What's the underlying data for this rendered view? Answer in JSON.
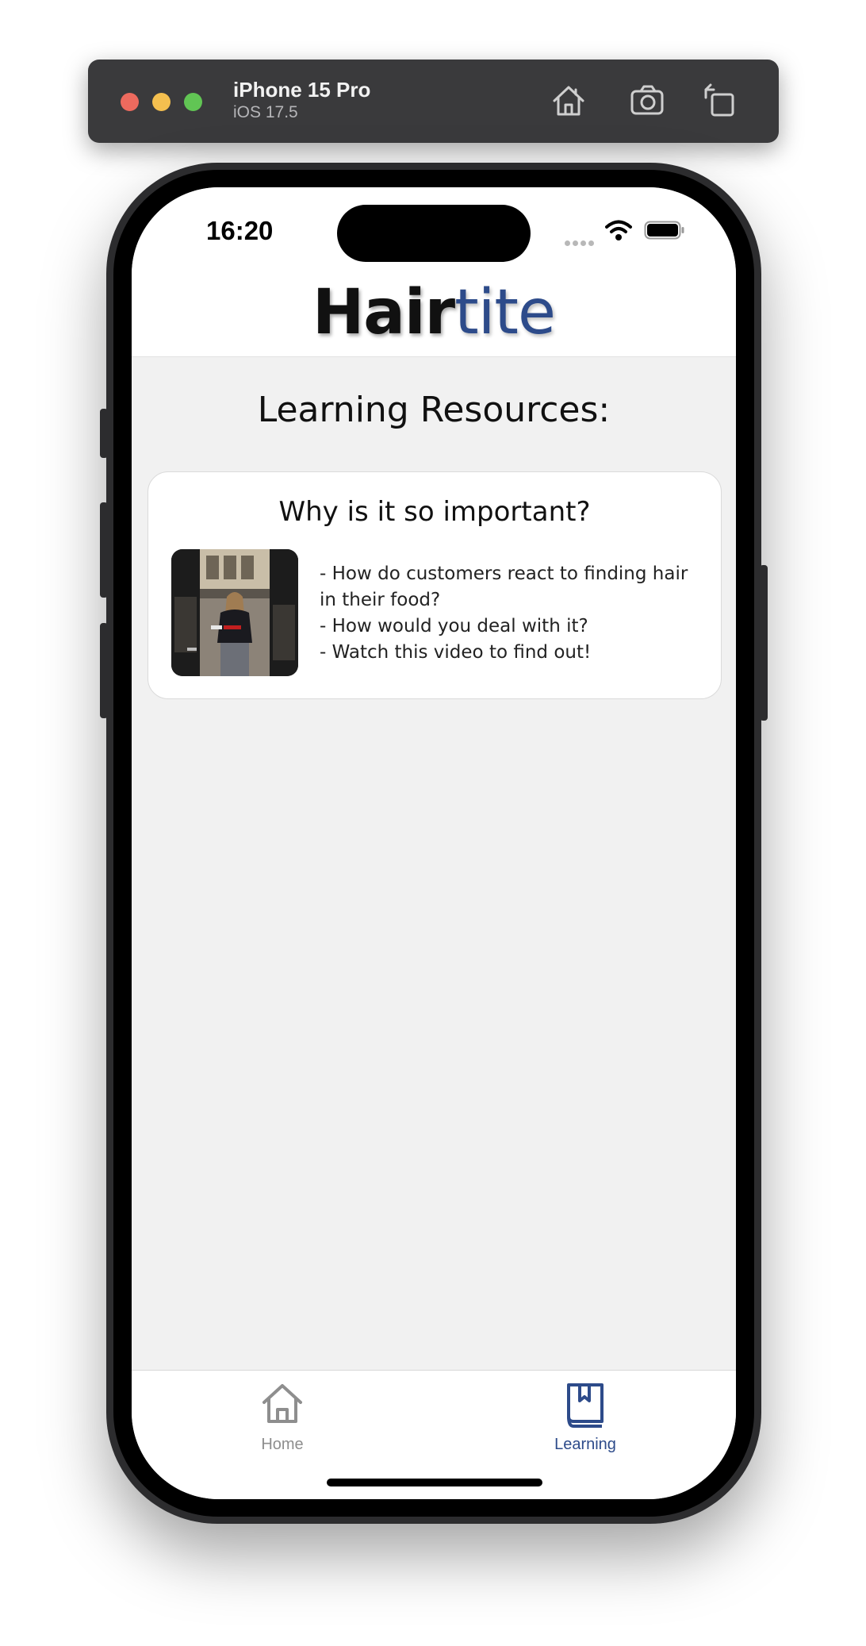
{
  "simulator": {
    "device_name": "iPhone 15 Pro",
    "os_version": "iOS 17.5"
  },
  "status_bar": {
    "time": "16:20"
  },
  "header": {
    "logo_part1": "Hair",
    "logo_part2": "tite"
  },
  "main": {
    "heading": "Learning Resources:",
    "cards": [
      {
        "title": "Why is it so important?",
        "lines": [
          "- How do customers react to finding hair in their food?",
          "- How would you deal with it?",
          "- Watch this video to find out!"
        ]
      }
    ]
  },
  "tabbar": {
    "tabs": [
      {
        "label": "Home",
        "icon": "home-icon",
        "active": false
      },
      {
        "label": "Learning",
        "icon": "book-icon",
        "active": true
      }
    ]
  },
  "colors": {
    "accent": "#2d4b8a",
    "inactive": "#8e8e8e",
    "background": "#f1f1f1"
  }
}
